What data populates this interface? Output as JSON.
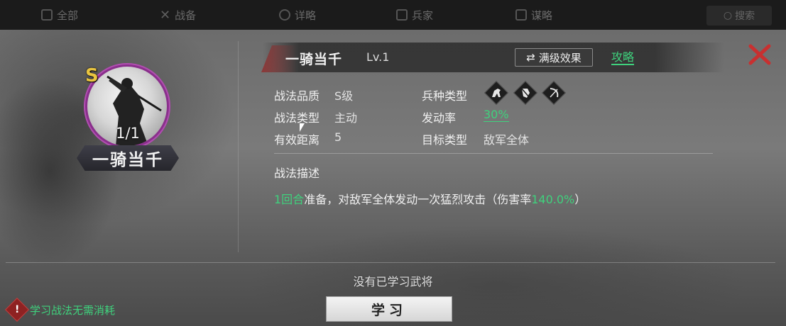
{
  "top_tabs": [
    {
      "label": "全部",
      "icon": "grid-icon"
    },
    {
      "label": "战备",
      "icon": "crossed-swords-icon"
    },
    {
      "label": "详略",
      "icon": "scroll-icon"
    },
    {
      "label": "兵家",
      "icon": "shield-icon"
    },
    {
      "label": "谋略",
      "icon": "book-icon"
    }
  ],
  "top_search": "搜索",
  "skill": {
    "grade": "S",
    "count": "1/1",
    "name": "一骑当千",
    "level": "Lv.1",
    "max_effect_button": "满级效果",
    "guide_link": "攻略"
  },
  "attributes": {
    "quality_label": "战法品质",
    "quality_value": "S级",
    "type_label": "战法类型",
    "type_value": "主动",
    "range_label": "有效距离",
    "range_value": "5",
    "troop_label": "兵种类型",
    "troop_icons": [
      "cavalry-icon",
      "shield-infantry-icon",
      "archer-icon"
    ],
    "rate_label": "发动率",
    "rate_value": "30%",
    "target_label": "目标类型",
    "target_value": "敌军全体"
  },
  "description": {
    "heading": "战法描述",
    "prefix_green": "1回合",
    "middle": "准备，对敌军全体发动一次猛烈攻击（伤害率",
    "damage_green": "140.0%",
    "suffix": "）"
  },
  "footer": {
    "no_general": "没有已学习武将",
    "learn_button": "学习",
    "tip": "学习战法无需消耗"
  },
  "colors": {
    "accent_green": "#3fd27d",
    "close_red": "#c83030",
    "grade_gold": "#e8c440",
    "portrait_ring": "#8a2f8c"
  }
}
